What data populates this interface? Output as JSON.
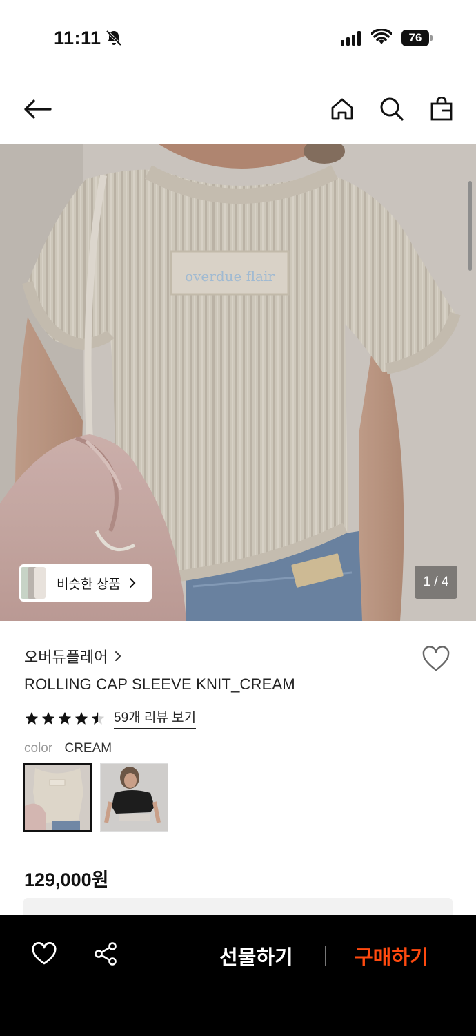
{
  "status_bar": {
    "time": "11:11",
    "battery": "76"
  },
  "nav": {
    "back_icon": "arrow-left-icon",
    "home_icon": "home-icon",
    "search_icon": "search-icon",
    "cart_icon": "shopping-bag-icon"
  },
  "gallery": {
    "counter": "1 / 4",
    "similar_label": "비슷한 상품",
    "current_index": 1,
    "total": 4,
    "embroidered_label": "overdue flair"
  },
  "product": {
    "brand": "오버듀플레어",
    "title": "ROLLING CAP SLEEVE KNIT_CREAM",
    "rating": 4.5,
    "review_link": "59개 리뷰 보기",
    "color_label": "color",
    "color_value": "CREAM",
    "swatches": [
      {
        "name": "CREAM",
        "selected": true
      },
      {
        "name": "BLACK",
        "selected": false
      }
    ],
    "price": "129,000원"
  },
  "bottom_bar": {
    "like_icon": "heart-icon",
    "share_icon": "share-icon",
    "gift_label": "선물하기",
    "buy_label": "구매하기",
    "buy_color": "#ff4a0f"
  }
}
